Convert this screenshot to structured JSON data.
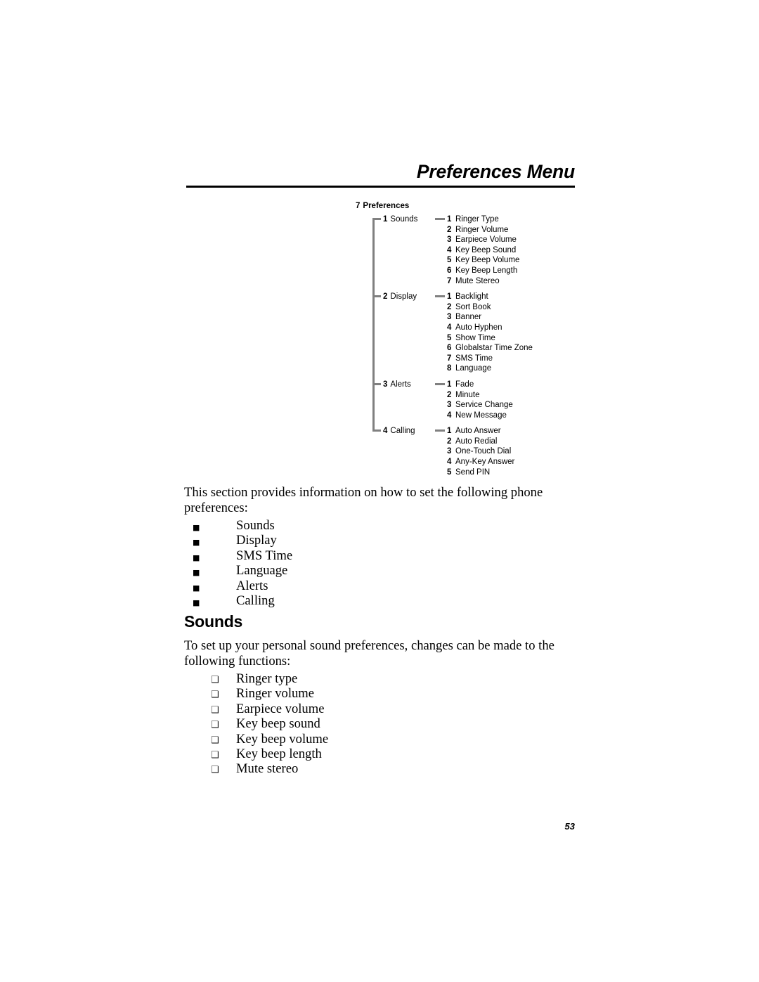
{
  "header": {
    "title": "Preferences Menu"
  },
  "menu_tree": {
    "root": {
      "number": "7",
      "label": "Preferences"
    },
    "groups": [
      {
        "number": "1",
        "label": "Sounds",
        "children": [
          {
            "number": "1",
            "label": "Ringer Type"
          },
          {
            "number": "2",
            "label": "Ringer Volume"
          },
          {
            "number": "3",
            "label": "Earpiece Volume"
          },
          {
            "number": "4",
            "label": "Key Beep Sound"
          },
          {
            "number": "5",
            "label": "Key Beep Volume"
          },
          {
            "number": "6",
            "label": "Key Beep Length"
          },
          {
            "number": "7",
            "label": "Mute Stereo"
          }
        ]
      },
      {
        "number": "2",
        "label": "Display",
        "children": [
          {
            "number": "1",
            "label": "Backlight"
          },
          {
            "number": "2",
            "label": "Sort Book"
          },
          {
            "number": "3",
            "label": "Banner"
          },
          {
            "number": "4",
            "label": "Auto Hyphen"
          },
          {
            "number": "5",
            "label": "Show Time"
          },
          {
            "number": "6",
            "label": "Globalstar Time Zone"
          },
          {
            "number": "7",
            "label": "SMS Time"
          },
          {
            "number": "8",
            "label": "Language"
          }
        ]
      },
      {
        "number": "3",
        "label": "Alerts",
        "children": [
          {
            "number": "1",
            "label": "Fade"
          },
          {
            "number": "2",
            "label": "Minute"
          },
          {
            "number": "3",
            "label": "Service Change"
          },
          {
            "number": "4",
            "label": "New Message"
          }
        ]
      },
      {
        "number": "4",
        "label": "Calling",
        "children": [
          {
            "number": "1",
            "label": "Auto Answer"
          },
          {
            "number": "2",
            "label": "Auto Redial"
          },
          {
            "number": "3",
            "label": "One-Touch Dial"
          },
          {
            "number": "4",
            "label": "Any-Key Answer"
          },
          {
            "number": "5",
            "label": "Send PIN"
          }
        ]
      }
    ]
  },
  "intro": {
    "paragraph": "This section provides information on how to set the following phone preferences:",
    "bullet_glyph": "■",
    "items": [
      "Sounds",
      "Display",
      "SMS Time",
      "Language",
      "Alerts",
      "Calling"
    ]
  },
  "sounds_section": {
    "heading": "Sounds",
    "paragraph": "To set up your personal sound preferences, changes can be made to the following functions:",
    "bullet_glyph": "❑",
    "items": [
      "Ringer type",
      "Ringer volume",
      "Earpiece volume",
      "Key beep sound",
      "Key beep volume",
      "Key beep length",
      "Mute stereo"
    ]
  },
  "footer": {
    "page_number": "53"
  },
  "colors": {
    "text": "#000000",
    "rule": "#000000",
    "tree_connector": "#808080",
    "background": "#ffffff"
  }
}
